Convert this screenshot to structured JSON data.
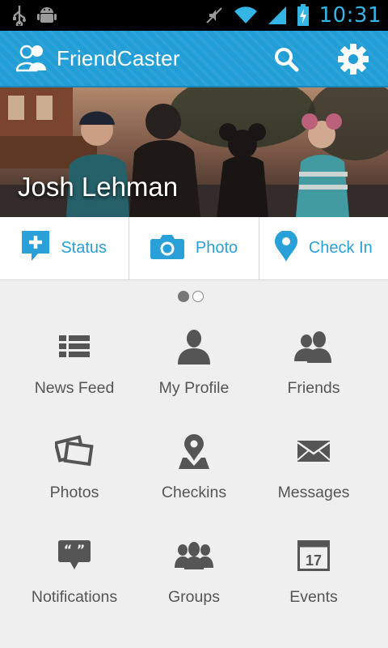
{
  "status_bar": {
    "time": "10:31",
    "icons": [
      "usb-icon",
      "android-debug-icon",
      "mute-icon",
      "wifi-icon",
      "signal-icon",
      "battery-charging-icon"
    ]
  },
  "action_bar": {
    "title": "FriendCaster",
    "logo_icon": "friends-logo-icon",
    "search_icon": "search-icon",
    "settings_icon": "gear-icon"
  },
  "profile": {
    "name": "Josh Lehman"
  },
  "quick_actions": [
    {
      "label": "Status",
      "icon": "add-status-icon"
    },
    {
      "label": "Photo",
      "icon": "camera-icon"
    },
    {
      "label": "Check In",
      "icon": "location-pin-icon"
    }
  ],
  "pager": {
    "pages": 2,
    "current": 1
  },
  "menu": [
    {
      "label": "News Feed",
      "icon": "list-icon"
    },
    {
      "label": "My Profile",
      "icon": "person-icon"
    },
    {
      "label": "Friends",
      "icon": "friends-icon"
    },
    {
      "label": "Photos",
      "icon": "photos-icon"
    },
    {
      "label": "Checkins",
      "icon": "map-pin-icon"
    },
    {
      "label": "Messages",
      "icon": "envelope-icon"
    },
    {
      "label": "Notifications",
      "icon": "speech-bubble-icon"
    },
    {
      "label": "Groups",
      "icon": "group-icon"
    },
    {
      "label": "Events",
      "icon": "calendar-icon",
      "calendar_day": "17"
    }
  ],
  "colors": {
    "accent": "#229ed6",
    "quick_action_text": "#2aa0d8",
    "menu_text": "#555555",
    "menu_icon": "#555555",
    "background": "#efefef"
  }
}
